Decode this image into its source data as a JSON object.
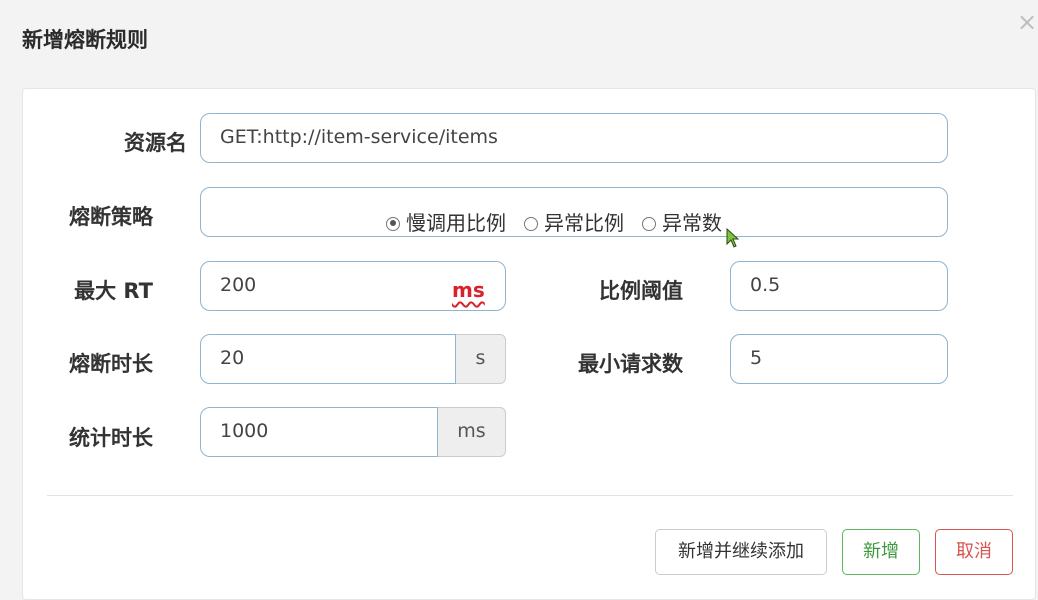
{
  "dialog": {
    "title": "新增熔断规则",
    "close_icon": "×"
  },
  "form": {
    "resource": {
      "label": "资源名",
      "value": "GET:http://item-service/items"
    },
    "strategy": {
      "label": "熔断策略",
      "options": [
        "慢调用比例",
        "异常比例",
        "异常数"
      ],
      "selected": "慢调用比例"
    },
    "max_rt": {
      "label": "最大 RT",
      "value": "200",
      "unit": "ms"
    },
    "ratio_threshold": {
      "label": "比例阈值",
      "value": "0.5"
    },
    "break_duration": {
      "label": "熔断时长",
      "value": "20",
      "unit": "s"
    },
    "min_requests": {
      "label": "最小请求数",
      "value": "5"
    },
    "stat_duration": {
      "label": "统计时长",
      "value": "1000",
      "unit": "ms"
    }
  },
  "buttons": {
    "add_continue": "新增并继续添加",
    "add": "新增",
    "cancel": "取消"
  },
  "colors": {
    "input_border": "#8fb4cf",
    "add_button": "#5cb85c",
    "cancel_button": "#d9534f",
    "unit_highlight": "#d9212e"
  }
}
